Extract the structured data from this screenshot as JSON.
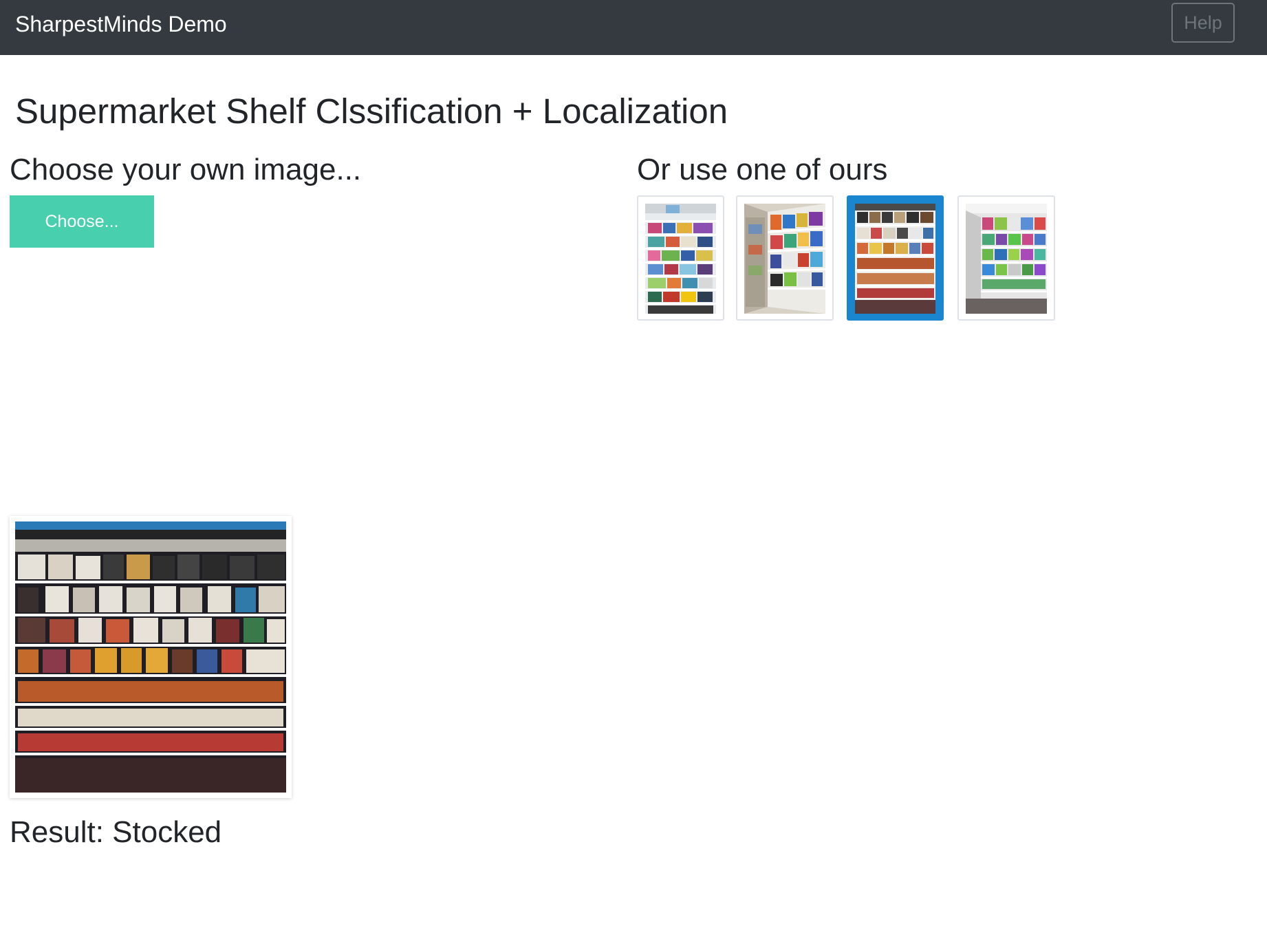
{
  "navbar": {
    "brand": "SharpestMinds Demo",
    "help_label": "Help"
  },
  "page": {
    "title": "Supermarket Shelf Clssification + Localization"
  },
  "upload": {
    "heading": "Choose your own image...",
    "button_label": "Choose..."
  },
  "samples": {
    "heading": "Or use one of ours",
    "selected_index": 2,
    "items": [
      {
        "name": "sample-1",
        "selected": false
      },
      {
        "name": "sample-2",
        "selected": false
      },
      {
        "name": "sample-3",
        "selected": true
      },
      {
        "name": "sample-4",
        "selected": false
      }
    ]
  },
  "result": {
    "label": "Result: Stocked"
  },
  "colors": {
    "navbar": "#343a40",
    "accent": "#48cfad",
    "selected": "#1a86d0"
  }
}
